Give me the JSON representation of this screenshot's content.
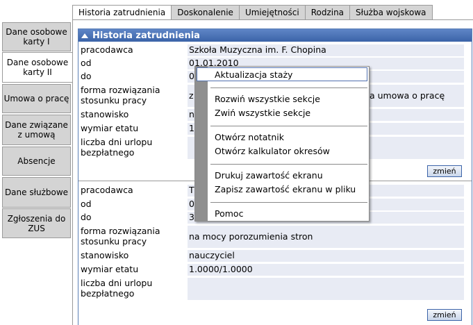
{
  "sidebar": {
    "items": [
      {
        "label": "Dane osobowe karty I",
        "active": false
      },
      {
        "label": "Dane osobowe karty II",
        "active": true
      },
      {
        "label": "Umowa o pracę",
        "active": false
      },
      {
        "label": "Dane związane z umową",
        "active": false
      },
      {
        "label": "Absencje",
        "active": false
      },
      {
        "label": "Dane służbowe",
        "active": false
      },
      {
        "label": "Zgłoszenia do ZUS",
        "active": false
      }
    ]
  },
  "tabs": [
    {
      "label": "Historia zatrudnienia",
      "active": true
    },
    {
      "label": "Doskonalenie",
      "active": false
    },
    {
      "label": "Umiejętności",
      "active": false
    },
    {
      "label": "Rodzina",
      "active": false
    },
    {
      "label": "Służba wojskowa",
      "active": false
    }
  ],
  "panel": {
    "title": "Historia zatrudnienia",
    "button_label": "zmień",
    "records": [
      {
        "pracodawca_label": "pracodawca",
        "pracodawca": "Szkoła Muzyczna im. F. Chopina",
        "od_label": "od",
        "od": "01.01.2010",
        "do_label": "do",
        "do": "0",
        "forma_label_1": "forma rozwiązania",
        "forma_label_2": "stosunku pracy",
        "forma": "z",
        "forma_suffix": "a umowa o pracę",
        "stanowisko_label": "stanowisko",
        "stanowisko": "na",
        "wymiar_label": "wymiar etatu",
        "wymiar": "1",
        "urlop_label_1": "liczba dni urlopu",
        "urlop_label_2": "bezpłatnego",
        "urlop": ""
      },
      {
        "pracodawca_label": "pracodawca",
        "pracodawca": "T",
        "od_label": "od",
        "od": "0",
        "do_label": "do",
        "do": "3",
        "forma_label_1": "forma rozwiązania",
        "forma_label_2": "stosunku pracy",
        "forma": "na mocy porozumienia stron",
        "stanowisko_label": "stanowisko",
        "stanowisko": "nauczyciel",
        "wymiar_label": "wymiar etatu",
        "wymiar": "1.0000/1.0000",
        "urlop_label_1": "liczba dni urlopu",
        "urlop_label_2": "bezpłatnego",
        "urlop": ""
      }
    ]
  },
  "context_menu": {
    "items": [
      "Aktualizacja staży",
      "Rozwiń wszystkie sekcje",
      "Zwiń wszystkie sekcje",
      "Otwórz notatnik",
      "Otwórz kalkulator okresów",
      "Drukuj zawartość ekranu",
      "Zapisz zawartość ekranu w pliku",
      "Pomoc"
    ]
  }
}
